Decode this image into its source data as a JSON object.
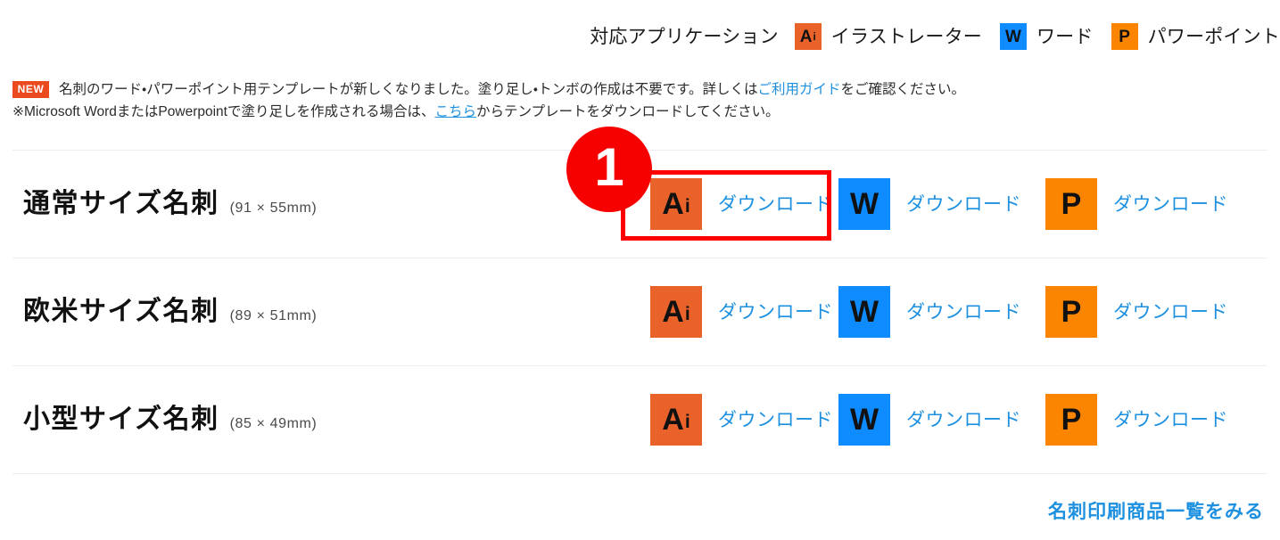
{
  "legend": {
    "label": "対応アプリケーション",
    "apps": [
      {
        "icon": "illustrator-icon",
        "badge_main": "A",
        "badge_sub": "i",
        "name": "イラストレーター",
        "color": "#e8622a"
      },
      {
        "icon": "word-icon",
        "badge_main": "W",
        "badge_sub": "",
        "name": "ワード",
        "color": "#0d8bff"
      },
      {
        "icon": "powerpoint-icon",
        "badge_main": "P",
        "badge_sub": "",
        "name": "パワーポイント",
        "color": "#fb8500"
      }
    ]
  },
  "notice": {
    "badge": "NEW",
    "line1_part1": "名刺のワード・パワーポイント用テンプレートが新しくなりました。塗り足し・トンボの作成は不要です。詳しくは",
    "line1_link": "ご利用ガイド",
    "line1_part2": "をご確認ください。",
    "line2_part1": "※Microsoft WordまたはPowerpointで塗り足しを作成される場合は、",
    "line2_link": "こちら",
    "line2_part2": "からテンプレートをダウンロードしてください。"
  },
  "rows": [
    {
      "name": "通常サイズ名刺",
      "size": "(91 × 55mm)",
      "downloads": [
        {
          "app": "illustrator",
          "badge_main": "A",
          "badge_sub": "i",
          "label": "ダウンロード"
        },
        {
          "app": "word",
          "badge_main": "W",
          "badge_sub": "",
          "label": "ダウンロード"
        },
        {
          "app": "powerpoint",
          "badge_main": "P",
          "badge_sub": "",
          "label": "ダウンロード"
        }
      ]
    },
    {
      "name": "欧米サイズ名刺",
      "size": "(89 × 51mm)",
      "downloads": [
        {
          "app": "illustrator",
          "badge_main": "A",
          "badge_sub": "i",
          "label": "ダウンロード"
        },
        {
          "app": "word",
          "badge_main": "W",
          "badge_sub": "",
          "label": "ダウンロード"
        },
        {
          "app": "powerpoint",
          "badge_main": "P",
          "badge_sub": "",
          "label": "ダウンロード"
        }
      ]
    },
    {
      "name": "小型サイズ名刺",
      "size": "(85 × 49mm)",
      "downloads": [
        {
          "app": "illustrator",
          "badge_main": "A",
          "badge_sub": "i",
          "label": "ダウンロード"
        },
        {
          "app": "word",
          "badge_main": "W",
          "badge_sub": "",
          "label": "ダウンロード"
        },
        {
          "app": "powerpoint",
          "badge_main": "P",
          "badge_sub": "",
          "label": "ダウンロード"
        }
      ]
    }
  ],
  "annotation": {
    "step_number": "1",
    "highlight_color": "#ff0000"
  },
  "footer": {
    "link_label": "名刺印刷商品一覧をみる"
  },
  "colors": {
    "link_blue": "#1e90e0",
    "illustrator_orange": "#e8622a",
    "word_blue": "#0d8bff",
    "powerpoint_orange": "#fb8500",
    "new_badge_red": "#ea4a1e",
    "annotation_red": "#f60000"
  }
}
